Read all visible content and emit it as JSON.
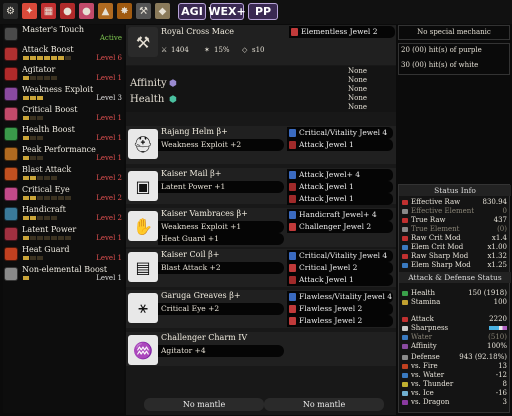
{
  "topbar": {
    "icons": [
      {
        "name": "gear-icon",
        "color": "#2b2b2b",
        "glyph": "⚙"
      },
      {
        "name": "paint-icon",
        "color": "#d94a3a",
        "glyph": "✦"
      },
      {
        "name": "grid-icon",
        "color": "#c03030",
        "glyph": "▦"
      },
      {
        "name": "potion-red-icon",
        "color": "#b02a2a",
        "glyph": "●"
      },
      {
        "name": "potion-pink-icon",
        "color": "#c24a6a",
        "glyph": "●"
      },
      {
        "name": "flask-icon",
        "color": "#b06a20",
        "glyph": "▲"
      },
      {
        "name": "bug-icon",
        "color": "#a05a10",
        "glyph": "✸"
      },
      {
        "name": "hammer-icon",
        "color": "#555555",
        "glyph": "⚒"
      },
      {
        "name": "pill-icon",
        "color": "#8a7a5a",
        "glyph": "◆"
      }
    ],
    "buttons": [
      "AGI",
      "WEX+",
      "PP"
    ]
  },
  "skills": [
    {
      "name": "Master's Touch",
      "level": "Active",
      "pips": 0,
      "max": 0,
      "color": "#4a4a4a",
      "active": true
    },
    {
      "name": "Attack Boost",
      "level": "Level 6",
      "pips": 6,
      "max": 7,
      "color": "#b03030"
    },
    {
      "name": "Agitator",
      "level": "Level 1",
      "pips": 1,
      "max": 5,
      "color": "#b02a2a"
    },
    {
      "name": "Weakness Exploit",
      "level": "Level 3",
      "pips": 3,
      "max": 3,
      "color": "#8a4aa0"
    },
    {
      "name": "Critical Boost",
      "level": "Level 1",
      "pips": 1,
      "max": 3,
      "color": "#c24a6a"
    },
    {
      "name": "Health Boost",
      "level": "Level 1",
      "pips": 1,
      "max": 3,
      "color": "#3a9a4a"
    },
    {
      "name": "Peak Performance",
      "level": "Level 1",
      "pips": 1,
      "max": 3,
      "color": "#b06a20"
    },
    {
      "name": "Blast Attack",
      "level": "Level 2",
      "pips": 2,
      "max": 5,
      "color": "#c05020"
    },
    {
      "name": "Critical Eye",
      "level": "Level 2",
      "pips": 2,
      "max": 7,
      "color": "#c24a8a"
    },
    {
      "name": "Handicraft",
      "level": "Level 2",
      "pips": 2,
      "max": 5,
      "color": "#3a7a9a"
    },
    {
      "name": "Latent Power",
      "level": "Level 1",
      "pips": 1,
      "max": 7,
      "color": "#a03040"
    },
    {
      "name": "Heat Guard",
      "level": "Level 1",
      "pips": 1,
      "max": 3,
      "color": "#c04020"
    },
    {
      "name": "Non-elemental Boost",
      "level": "Level 1",
      "pips": 1,
      "max": 1,
      "color": "#8a8a8a"
    }
  ],
  "weapon": {
    "name": "Royal Cross Mace",
    "attack": "1404",
    "affinity": "15%",
    "element": "s10",
    "deco": "Elementless Jewel 2",
    "affinity_label": "Affinity",
    "health_label": "Health",
    "nones": [
      "None",
      "None",
      "None",
      "None",
      "None"
    ]
  },
  "armor": [
    {
      "name": "Rajang Helm β+",
      "skills": [
        "Weakness Exploit +2"
      ],
      "decos": [
        "Critical/Vitality Jewel 4",
        "Attack Jewel 1"
      ],
      "icon": "helm-icon",
      "glyph": "⛑"
    },
    {
      "name": "Kaiser Mail β+",
      "skills": [
        "Latent Power +1"
      ],
      "decos": [
        "Attack Jewel+ 4",
        "Attack Jewel 1",
        "Attack Jewel 1"
      ],
      "icon": "chest-armor-icon",
      "glyph": "▣"
    },
    {
      "name": "Kaiser Vambraces β+",
      "skills": [
        "Weakness Exploit +1",
        "Heat Guard +1"
      ],
      "decos": [
        "Handicraft Jewel+ 4",
        "Challenger Jewel 2"
      ],
      "icon": "gauntlet-icon",
      "glyph": "✋"
    },
    {
      "name": "Kaiser Coil β+",
      "skills": [
        "Blast Attack +2"
      ],
      "decos": [
        "Critical/Vitality Jewel 4",
        "Critical Jewel 2",
        "Attack Jewel 1"
      ],
      "icon": "waist-icon",
      "glyph": "▤"
    },
    {
      "name": "Garuga Greaves β+",
      "skills": [
        "Critical Eye +2"
      ],
      "decos": [
        "Flawless/Vitality Jewel 4",
        "Flawless Jewel 2",
        "Flawless Jewel 2"
      ],
      "icon": "greaves-icon",
      "glyph": "⚹"
    },
    {
      "name": "Challenger Charm IV",
      "skills": [
        "Agitator +4"
      ],
      "decos": [],
      "icon": "charm-icon",
      "glyph": "♒"
    }
  ],
  "mantles": [
    "No mantle",
    "No mantle"
  ],
  "mechanic": "No special mechanic",
  "hits": [
    "20 (00) hit(s) of purple",
    "30 (00) hit(s) of white"
  ],
  "status_title": "Status Info",
  "attack_stats": [
    {
      "label": "Effective Raw",
      "value": "830.94",
      "dim": false,
      "color": "#c03030"
    },
    {
      "label": "Effective Element",
      "value": "0",
      "dim": true,
      "color": "#888"
    },
    {
      "label": "True Raw",
      "value": "437",
      "dim": false,
      "color": "#c03030"
    },
    {
      "label": "True Element",
      "value": "(0)",
      "dim": true,
      "color": "#888"
    },
    {
      "label": "Raw Crit Mod",
      "value": "x1.4",
      "dim": false,
      "color": "#c03030"
    },
    {
      "label": "Elem Crit Mod",
      "value": "x1.00",
      "dim": false,
      "color": "#3a7ac0"
    },
    {
      "label": "Raw Sharp Mod",
      "value": "x1.32",
      "dim": false,
      "color": "#c03030"
    },
    {
      "label": "Elem Sharp Mod",
      "value": "x1.25",
      "dim": false,
      "color": "#3a7ac0"
    }
  ],
  "def_title": "Attack & Defense Status",
  "health_stats": [
    {
      "label": "Health",
      "value": "150 (1918)",
      "dim": false,
      "color": "#3aa04a"
    },
    {
      "label": "Stamina",
      "value": "100",
      "dim": false,
      "color": "#c0a030"
    }
  ],
  "combat_stats": [
    {
      "label": "Attack",
      "value": "2220",
      "dim": false,
      "color": "#c03030"
    },
    {
      "label": "Sharpness",
      "value": "",
      "dim": false,
      "color": "#c8c8c8",
      "sharp": true
    },
    {
      "label": "Water",
      "value": "(510)",
      "dim": true,
      "color": "#3a7ac0"
    },
    {
      "label": "Affinity",
      "value": "100%",
      "dim": false,
      "color": "#8a4aa0"
    }
  ],
  "defense_stats": [
    {
      "label": "Defense",
      "value": "943 (92.18%)",
      "dim": false,
      "color": "#8a8a8a"
    },
    {
      "label": "vs. Fire",
      "value": "13",
      "dim": false,
      "color": "#c04020"
    },
    {
      "label": "vs. Water",
      "value": "-12",
      "dim": false,
      "color": "#3a7ac0"
    },
    {
      "label": "vs. Thunder",
      "value": "8",
      "dim": false,
      "color": "#c0b030"
    },
    {
      "label": "vs. Ice",
      "value": "-16",
      "dim": false,
      "color": "#70b0d0"
    },
    {
      "label": "vs. Dragon",
      "value": "3",
      "dim": false,
      "color": "#8a3aa0"
    }
  ],
  "colors": {
    "rarity_icon": "#e8e8e8",
    "deco4": "#3a6ac0",
    "deco2": "#c03a3a",
    "deco1": "#a02a2a",
    "level_text": "#e05050"
  }
}
